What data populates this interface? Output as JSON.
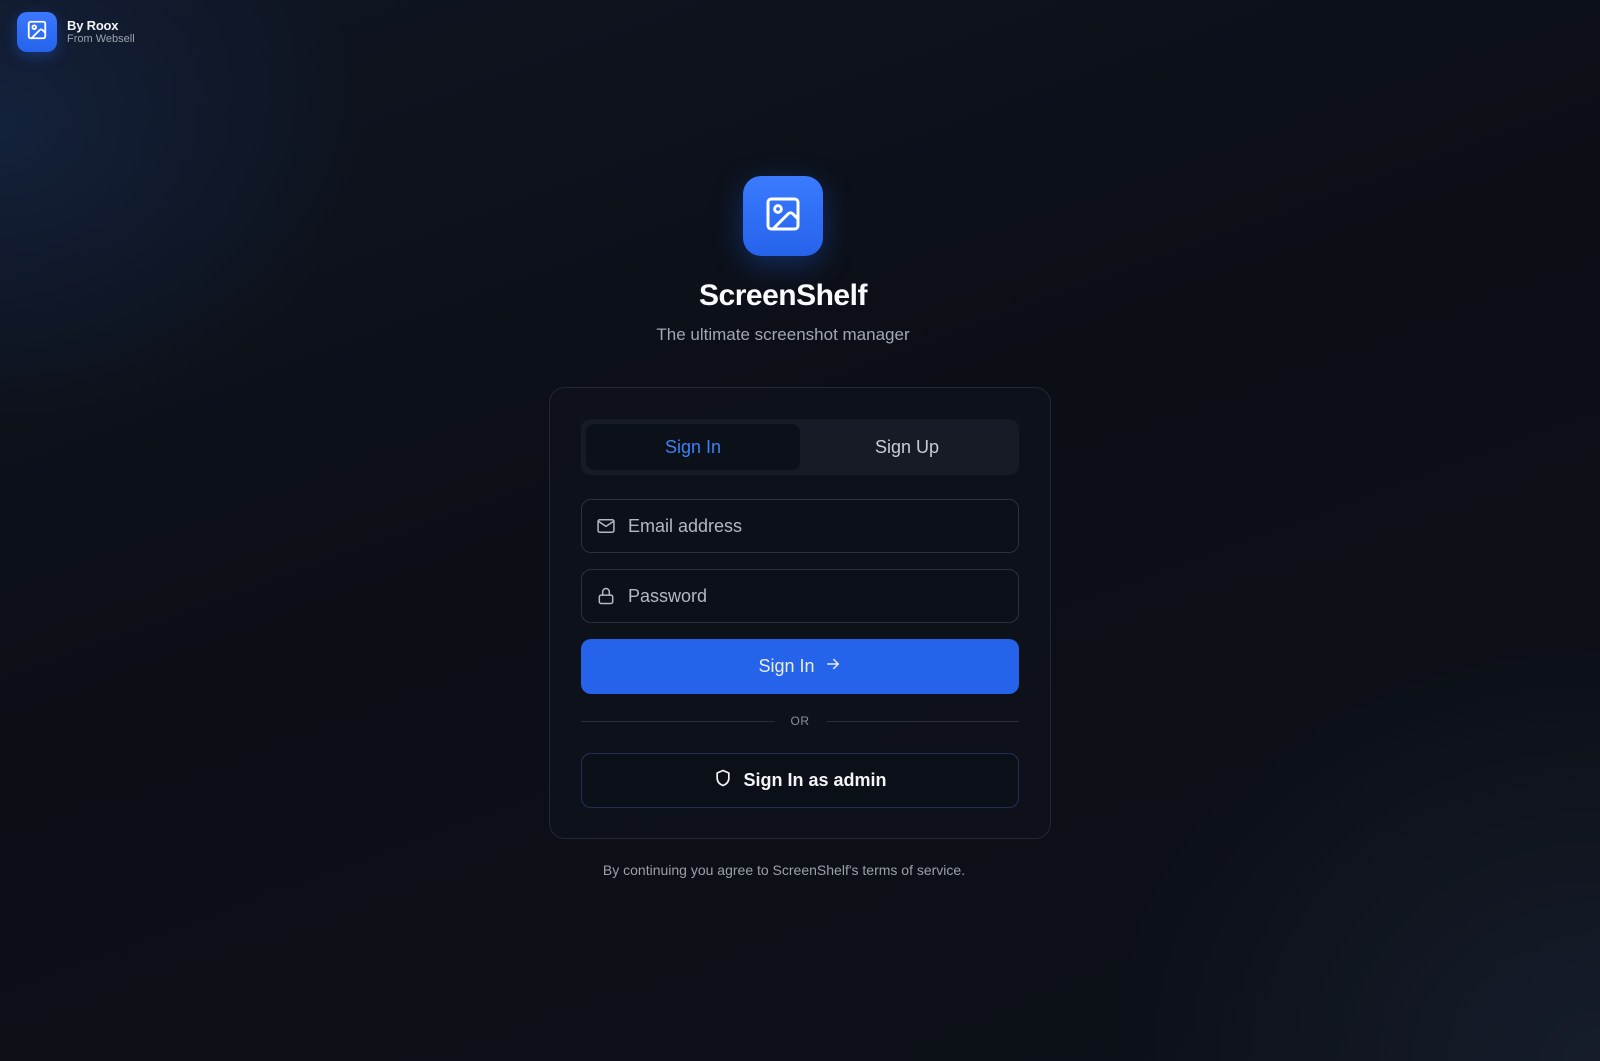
{
  "brand": {
    "title": "By Roox",
    "subtitle": "From Websell",
    "icon": "image-icon"
  },
  "app": {
    "name": "ScreenShelf",
    "tagline": "The ultimate screenshot manager",
    "icon": "image-icon",
    "accent_color": "#2563eb"
  },
  "auth": {
    "tabs": [
      {
        "label": "Sign In",
        "active": true
      },
      {
        "label": "Sign Up",
        "active": false
      }
    ],
    "email": {
      "placeholder": "Email address",
      "value": "",
      "icon": "mail-icon"
    },
    "password": {
      "placeholder": "Password",
      "value": "",
      "icon": "lock-icon"
    },
    "submit_label": "Sign In",
    "submit_icon": "arrow-right-icon",
    "divider_label": "OR",
    "admin_label": "Sign In as admin",
    "admin_icon": "shield-icon"
  },
  "footer": {
    "terms": "By continuing you agree to ScreenShelf's terms of service."
  }
}
